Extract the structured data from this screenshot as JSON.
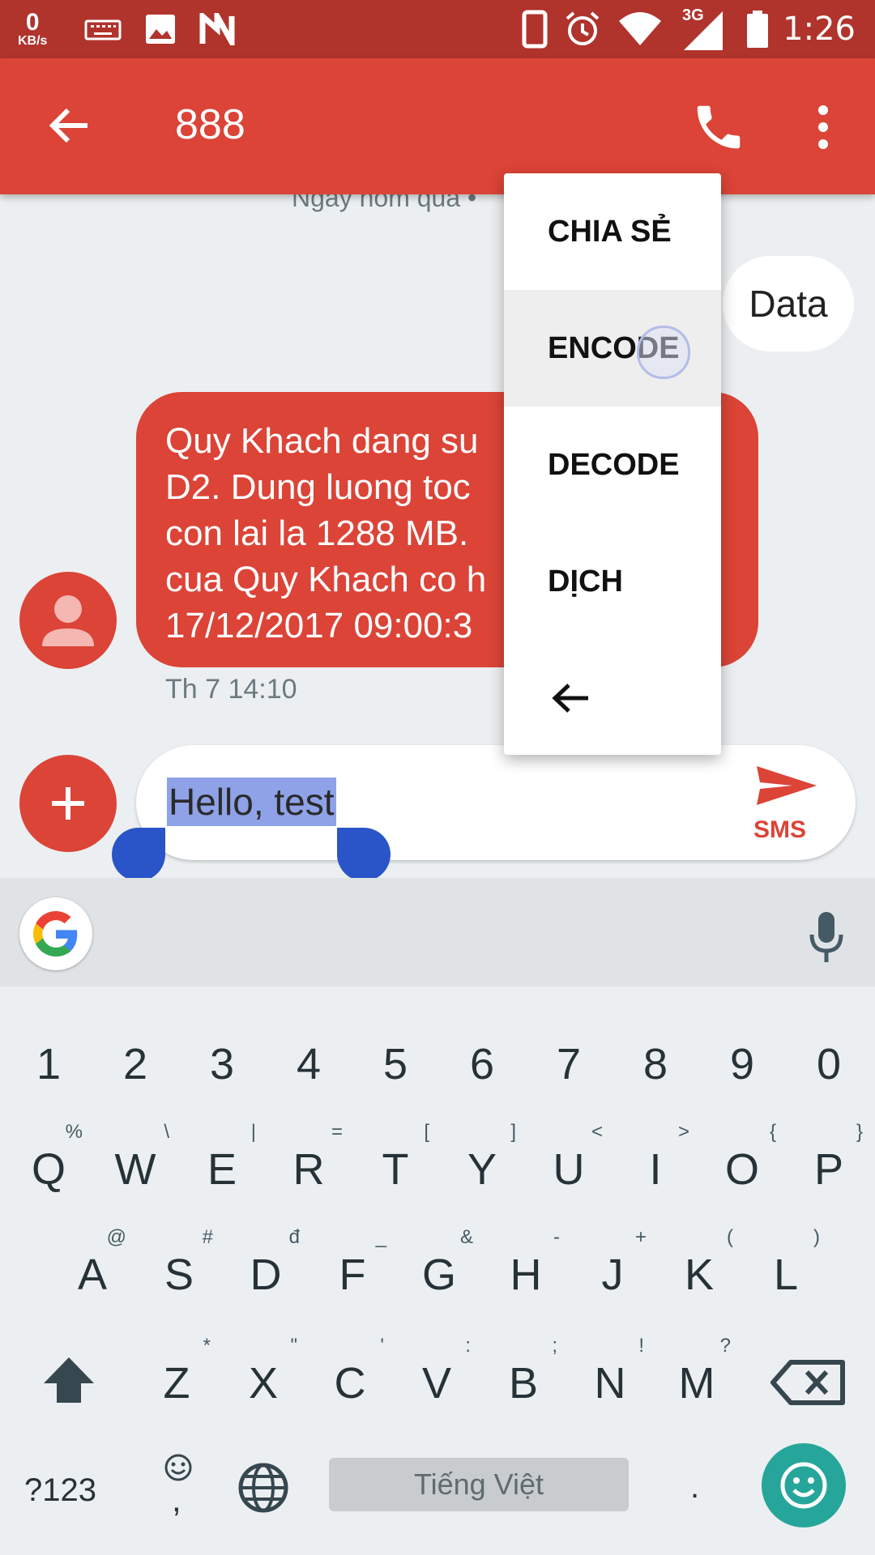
{
  "status_bar": {
    "net_speed_value": "0",
    "net_speed_unit": "KB/s",
    "network_type": "3G",
    "time": "1:26",
    "icons": [
      "keyboard-icon",
      "image-icon",
      "n-logo-icon",
      "phone-outline-icon",
      "alarm-icon",
      "wifi-icon",
      "signal-icon",
      "battery-icon"
    ]
  },
  "app_bar": {
    "title": "888",
    "icons": [
      "back-arrow-icon",
      "phone-icon",
      "more-vert-icon"
    ],
    "color": "#db4437"
  },
  "conversation": {
    "date_divider": "Ngày hôm qua •",
    "sent_message": "Data",
    "received_message_lines": [
      "Quy Khach dang su",
      "D2. Dung luong toc",
      "con lai la 1288 MB.",
      "cua Quy Khach co h",
      "17/12/2017 09:00:3"
    ],
    "received_time": "Th 7 14:10"
  },
  "compose": {
    "text": "Hello, test",
    "send_label": "SMS"
  },
  "popup_menu": {
    "items": [
      "CHIA SẺ",
      "ENCODE",
      "DECODE",
      "DỊCH"
    ],
    "highlighted": "ENCODE",
    "back_icon": "back-arrow-icon"
  },
  "keyboard": {
    "number_row": [
      "1",
      "2",
      "3",
      "4",
      "5",
      "6",
      "7",
      "8",
      "9",
      "0"
    ],
    "row1": [
      {
        "k": "Q",
        "h": "%"
      },
      {
        "k": "W",
        "h": "\\"
      },
      {
        "k": "E",
        "h": "|"
      },
      {
        "k": "R",
        "h": "="
      },
      {
        "k": "T",
        "h": "["
      },
      {
        "k": "Y",
        "h": "]"
      },
      {
        "k": "U",
        "h": "<"
      },
      {
        "k": "I",
        "h": ">"
      },
      {
        "k": "O",
        "h": "{"
      },
      {
        "k": "P",
        "h": "}"
      }
    ],
    "row2": [
      {
        "k": "A",
        "h": "@"
      },
      {
        "k": "S",
        "h": "#"
      },
      {
        "k": "D",
        "h": "đ"
      },
      {
        "k": "F",
        "h": "_"
      },
      {
        "k": "G",
        "h": "&"
      },
      {
        "k": "H",
        "h": "-"
      },
      {
        "k": "J",
        "h": "+"
      },
      {
        "k": "K",
        "h": "("
      },
      {
        "k": "L",
        "h": ")"
      }
    ],
    "row3": [
      {
        "k": "Z",
        "h": "*"
      },
      {
        "k": "X",
        "h": "\""
      },
      {
        "k": "C",
        "h": "'"
      },
      {
        "k": "V",
        "h": ":"
      },
      {
        "k": "B",
        "h": ";"
      },
      {
        "k": "N",
        "h": "!"
      },
      {
        "k": "M",
        "h": "?"
      }
    ],
    "symbols_label": "?123",
    "space_label": "Tiếng Việt",
    "period_label": ".",
    "comma_label": ","
  }
}
